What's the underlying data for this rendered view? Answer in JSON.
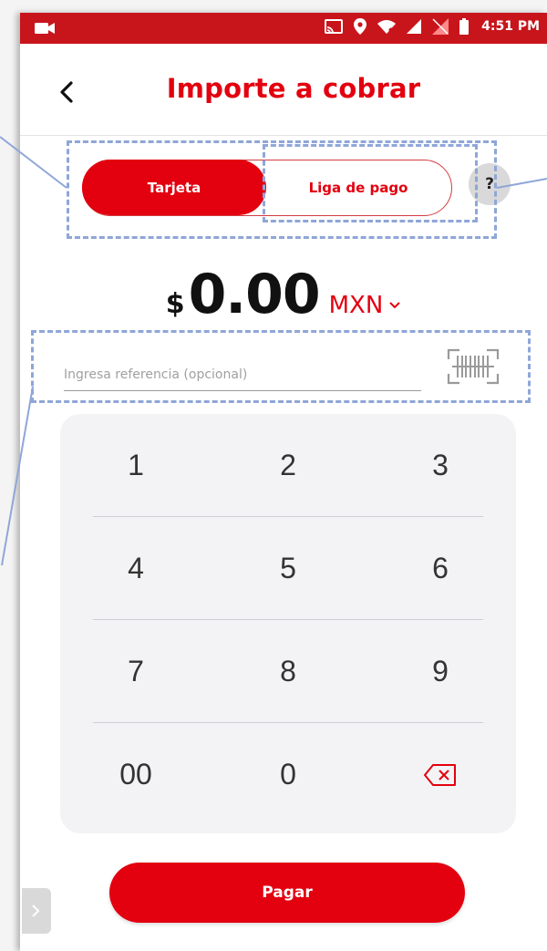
{
  "status_bar": {
    "time": "4:51 PM"
  },
  "header": {
    "title": "Importe a cobrar"
  },
  "payment_mode": {
    "options": [
      "Tarjeta",
      "Liga de pago"
    ],
    "selected": "Tarjeta",
    "help_label": "?"
  },
  "amount": {
    "symbol": "$",
    "value": "0.00",
    "currency": "MXN"
  },
  "reference": {
    "placeholder": "Ingresa referencia (opcional)",
    "value": ""
  },
  "keypad": {
    "rows": [
      [
        "1",
        "2",
        "3"
      ],
      [
        "4",
        "5",
        "6"
      ],
      [
        "7",
        "8",
        "9"
      ],
      [
        "00",
        "0",
        "backspace"
      ]
    ]
  },
  "actions": {
    "pay_label": "Pagar"
  },
  "colors": {
    "brand_red": "#e3000f",
    "annotation_blue": "#8fa6d8",
    "keypad_bg": "#f3f3f5"
  },
  "icons": [
    "video-camera-icon",
    "cast-icon",
    "location-pin-icon",
    "wifi-icon",
    "signal-icon",
    "no-signal-icon",
    "battery-icon",
    "back-arrow-icon",
    "chevron-down-icon",
    "barcode-scan-icon",
    "backspace-icon",
    "side-arrow-icon"
  ]
}
